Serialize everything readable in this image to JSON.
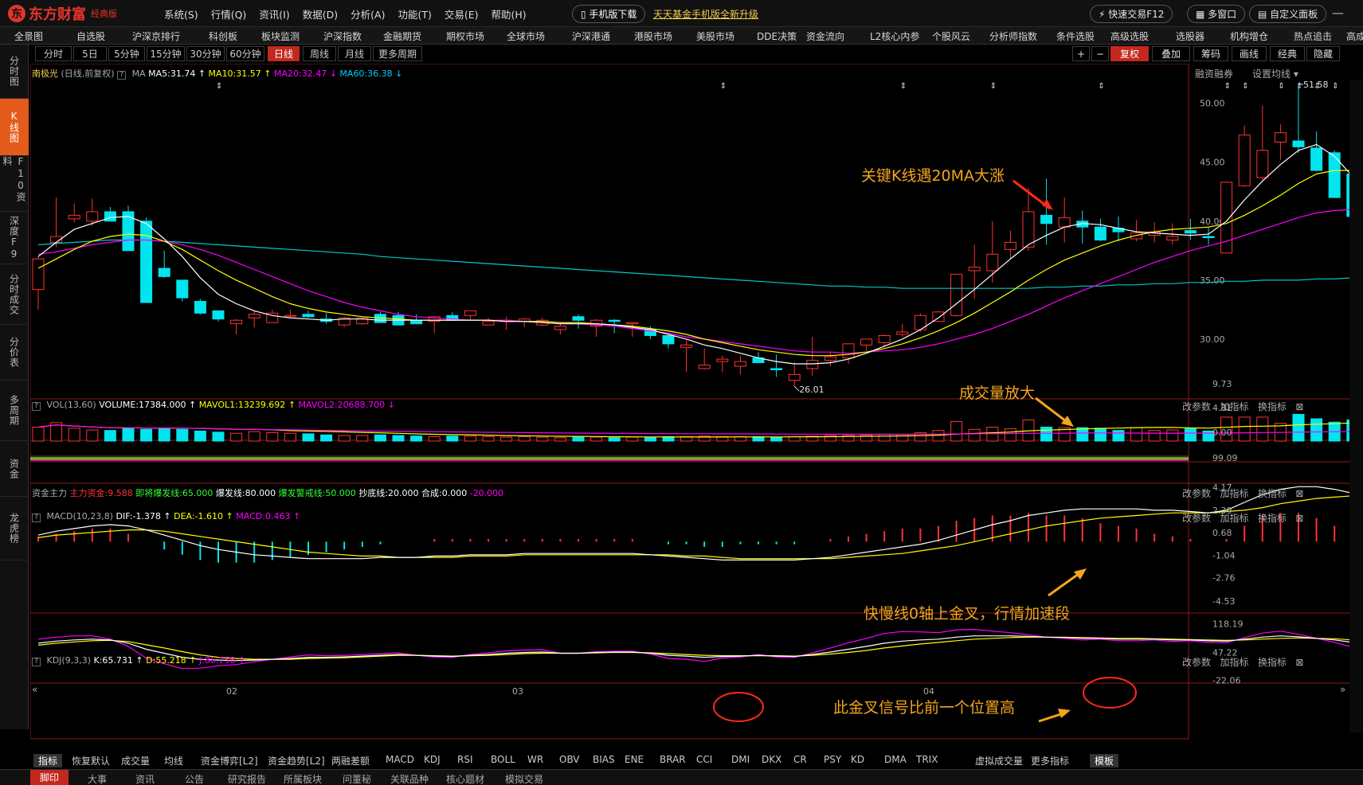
{
  "app": {
    "logo_text": "东方财富",
    "edition": "经典版"
  },
  "menu": [
    "系统(S)",
    "行情(Q)",
    "资讯(I)",
    "数据(D)",
    "分析(A)",
    "功能(T)",
    "交易(E)",
    "帮助(H)"
  ],
  "header": {
    "mobile_download": "手机版下载",
    "upgrade_link": "天天基金手机版全新升级",
    "quick_trade": "快速交易F12",
    "multi_window": "多窗口",
    "custom_panel": "自定义面板"
  },
  "nav": [
    "全景图",
    "自选股",
    "沪深京排行",
    "科创板",
    "板块监测",
    "沪深指数",
    "金融期货",
    "期权市场",
    "全球市场",
    "沪深港通",
    "港股市场",
    "美股市场",
    "DDE决策",
    "资金流向",
    "L2核心内参",
    "个股风云",
    "分析师指数",
    "条件选股",
    "高级选股",
    "选股器",
    "机构增仓",
    "热点追击",
    "高成长性",
    "机构"
  ],
  "periods": [
    "分时",
    "5日",
    "5分钟",
    "15分钟",
    "30分钟",
    "60分钟",
    "日线",
    "周线",
    "月线",
    "更多周期"
  ],
  "active_period": "日线",
  "toolbar": {
    "plus": "+",
    "minus": "−",
    "adjust": "复权",
    "overlay": "叠加",
    "chips": "筹码",
    "draw": "画线",
    "classic": "经典",
    "hide": "隐藏"
  },
  "sidebar": [
    "分时图",
    "K线图",
    "F10资料",
    "深度F9",
    "分时成交",
    "分价表",
    "多周期",
    "资金",
    "龙虎榜"
  ],
  "active_side": "K线图",
  "stock": {
    "name": "南极光",
    "mode": "(日线,前复权)",
    "ind": "MA",
    "ma5": "MA5:31.74",
    "ma10": "MA10:31.57",
    "ma20": "MA20:32.47",
    "ma60": "MA60:36.38",
    "margin": "融资融券",
    "set_ma": "设置均线"
  },
  "price_axis": [
    "50.00",
    "45.00",
    "40.00",
    "35.00",
    "30.00"
  ],
  "price_high": "51.58",
  "price_low": "26.01",
  "volume": {
    "title": "VOL(13,60)",
    "v": "VOLUME:17384.000",
    "m1": "MAVOL1:13239.692",
    "m2": "MAVOL2:20688.700",
    "axis": [
      "9.73",
      "4.81",
      "0.00"
    ]
  },
  "fund": {
    "title": "资金主力",
    "main": "主力资金:9.588",
    "about": "即将爆发线:65.000",
    "burst": "爆发线:80.000",
    "warn": "爆发警戒线:50.000",
    "bottom": "抄底线:20.000",
    "combo": "合成:0.000",
    "neg": "-20.000",
    "axis": "99.09"
  },
  "macd": {
    "title": "MACD(10,23,8)",
    "dif": "DIF:-1.378",
    "dea": "DEA:-1.610",
    "macd": "MACD:0.463",
    "axis": [
      "4.17",
      "2.39",
      "0.68",
      "-1.04",
      "-2.76",
      "-4.53"
    ]
  },
  "kdj": {
    "title": "KDJ(9,3,3)",
    "k": "K:65.731",
    "d": "D:55.218",
    "j": "J:86.758",
    "axis": [
      "118.19",
      "47.22",
      "-22.06"
    ]
  },
  "panel_controls": {
    "param": "改参数",
    "add": "加指标",
    "swap": "换指标"
  },
  "x_axis": [
    "02",
    "03",
    "04"
  ],
  "annotations": {
    "a1": "关键K线遇20MA大涨",
    "a2": "成交量放大",
    "a3": "快慢线0轴上金叉，行情加速段",
    "a4": "此金叉信号比前一个位置高"
  },
  "indicator_tabs": [
    "指标",
    "恢复默认",
    "成交量",
    "均线",
    "资金博弈[L2]",
    "资金趋势[L2]",
    "两融差额",
    "MACD",
    "KDJ",
    "RSI",
    "BOLL",
    "WR",
    "OBV",
    "BIAS",
    "ENE",
    "BRAR",
    "CCI",
    "DMI",
    "DKX",
    "CR",
    "PSY",
    "KD",
    "DMA",
    "TRIX",
    "虚拟成交量",
    "更多指标",
    "模板"
  ],
  "bottom_tabs": [
    "脚印",
    "大事",
    "资讯",
    "公告",
    "研究报告",
    "所属板块",
    "问董秘",
    "关联品种",
    "核心题材",
    "模拟交易"
  ],
  "colors": {
    "up": "#ff3232",
    "down": "#00e5ee",
    "ma5": "#ffffff",
    "ma10": "#ffff00",
    "ma20": "#ff00ff",
    "ma60": "#00c8c8",
    "accent": "#c3281e",
    "annotation": "#f4a51c"
  },
  "chart_data": {
    "type": "candlestick",
    "opens": [
      34.2,
      38.2,
      40.2,
      40.0,
      40.8,
      40.8,
      40.0,
      36.0,
      35.0,
      33.2,
      32.4,
      31.3,
      31.8,
      31.4,
      32.0,
      32.1,
      31.7,
      31.2,
      31.3,
      32.1,
      32.0,
      31.6,
      31.5,
      32.0,
      32.0,
      31.2,
      31.6,
      31.5,
      31.2,
      30.8,
      31.9,
      31.1,
      31.6,
      31.4,
      30.8,
      30.3,
      29.3,
      27.5,
      28.1,
      27.7,
      28.4,
      27.5,
      26.5,
      27.5,
      28.2,
      28.4,
      29.5,
      29.7,
      30.4,
      30.8,
      31.5,
      32.0,
      35.8,
      35.8,
      37.6,
      37.8,
      40.5,
      39.5,
      40.0,
      39.5,
      39.4,
      38.5,
      38.8,
      38.4,
      39.2,
      38.7,
      37.3,
      43.0,
      43.7,
      46.7,
      46.8,
      46.2,
      45.8,
      44.0,
      41.7,
      36.2,
      33.9,
      27.9,
      31.6
    ],
    "highs": [
      37.0,
      42.0,
      41.5,
      41.9,
      41.2,
      41.3,
      40.3,
      37.5,
      35.0,
      33.4,
      32.4,
      31.7,
      32.4,
      32.5,
      32.5,
      32.4,
      32.2,
      31.9,
      31.9,
      32.3,
      32.3,
      32.1,
      31.8,
      32.3,
      32.2,
      31.8,
      31.9,
      31.8,
      31.8,
      31.4,
      32.1,
      31.7,
      31.7,
      31.4,
      31.1,
      30.3,
      29.9,
      29.2,
      28.6,
      28.6,
      28.9,
      28.7,
      28.0,
      30.2,
      28.9,
      29.3,
      30.0,
      30.4,
      31.3,
      32.2,
      32.4,
      33.0,
      38.0,
      40.0,
      39.2,
      42.8,
      43.6,
      42.0,
      40.9,
      40.2,
      40.4,
      40.1,
      39.9,
      39.8,
      40.2,
      39.5,
      42.5,
      48.1,
      49.8,
      48.2,
      51.6,
      47.6,
      46.0,
      45.8,
      42.5,
      39.0,
      34.6,
      31.7,
      31.7
    ],
    "lows": [
      32.5,
      37.8,
      39.9,
      39.6,
      40.7,
      38.6,
      35.8,
      35.2,
      33.2,
      32.1,
      31.5,
      30.4,
      31.0,
      31.4,
      31.8,
      31.8,
      31.3,
      31.0,
      31.2,
      31.7,
      31.6,
      31.5,
      30.5,
      31.6,
      31.6,
      31.2,
      30.8,
      31.0,
      31.1,
      30.4,
      30.9,
      30.2,
      30.5,
      30.2,
      30.0,
      29.2,
      27.2,
      27.4,
      27.2,
      27.0,
      28.0,
      26.8,
      26.0,
      26.9,
      27.7,
      27.9,
      29.0,
      29.3,
      30.2,
      30.6,
      31.5,
      31.9,
      33.4,
      34.8,
      36.8,
      37.5,
      38.0,
      38.2,
      38.1,
      38.3,
      38.3,
      38.3,
      38.2,
      38.0,
      38.4,
      38.0,
      37.3,
      42.9,
      43.5,
      45.2,
      45.8,
      44.2,
      42.2,
      42.5,
      33.9,
      33.8,
      27.5,
      27.4,
      28.0
    ],
    "closes": [
      36.8,
      38.7,
      40.5,
      40.8,
      40.0,
      37.5,
      33.1,
      35.3,
      33.5,
      32.2,
      31.7,
      31.6,
      32.1,
      32.2,
      32.0,
      31.9,
      31.5,
      31.8,
      31.8,
      31.4,
      31.2,
      31.3,
      31.9,
      31.6,
      32.4,
      31.5,
      31.6,
      31.7,
      31.6,
      31.1,
      31.6,
      31.6,
      31.5,
      31.4,
      30.3,
      29.6,
      29.5,
      27.8,
      28.3,
      28.1,
      28.0,
      27.4,
      27.0,
      28.2,
      28.5,
      29.6,
      30.0,
      30.3,
      30.6,
      32.0,
      32.3,
      35.5,
      36.1,
      37.2,
      38.2,
      40.8,
      39.8,
      40.3,
      39.5,
      38.4,
      39.1,
      39.0,
      39.1,
      38.7,
      39.0,
      38.6,
      43.3,
      47.3,
      46.0,
      47.5,
      46.3,
      44.3,
      42.0,
      40.4,
      37.1,
      34.8,
      27.8,
      31.3,
      31.6
    ],
    "ma5": [
      37.0,
      38.2,
      39.3,
      39.8,
      40.3,
      40.4,
      39.8,
      38.5,
      37.0,
      35.2,
      33.8,
      33.0,
      32.4,
      32.0,
      31.8,
      31.7,
      31.6,
      31.7,
      31.7,
      31.6,
      31.6,
      31.6,
      31.6,
      31.6,
      31.6,
      31.6,
      31.5,
      31.5,
      31.4,
      31.3,
      31.3,
      31.3,
      31.2,
      31.0,
      30.8,
      30.4,
      30.0,
      29.5,
      29.2,
      28.8,
      28.4,
      28.1,
      27.9,
      27.9,
      28.0,
      28.3,
      28.8,
      29.4,
      30.0,
      30.8,
      31.8,
      33.0,
      34.2,
      35.5,
      36.8,
      38.0,
      38.8,
      39.5,
      39.8,
      39.7,
      39.4,
      39.1,
      39.0,
      38.9,
      38.8,
      38.9,
      40.0,
      41.8,
      43.4,
      44.8,
      46.0,
      46.5,
      45.5,
      43.8,
      41.6,
      39.0,
      36.0,
      33.5,
      32.5
    ],
    "ma10": [
      36.0,
      36.8,
      37.6,
      38.3,
      38.7,
      38.9,
      38.8,
      38.3,
      37.6,
      36.7,
      35.8,
      35.0,
      34.3,
      33.6,
      33.0,
      32.6,
      32.3,
      32.1,
      31.9,
      31.8,
      31.7,
      31.6,
      31.6,
      31.6,
      31.6,
      31.6,
      31.5,
      31.5,
      31.5,
      31.4,
      31.4,
      31.3,
      31.2,
      31.1,
      30.9,
      30.7,
      30.4,
      30.0,
      29.7,
      29.4,
      29.1,
      28.9,
      28.7,
      28.6,
      28.6,
      28.7,
      28.9,
      29.2,
      29.6,
      30.1,
      30.7,
      31.4,
      32.2,
      33.1,
      34.0,
      35.0,
      35.9,
      36.7,
      37.3,
      37.9,
      38.4,
      38.8,
      39.1,
      39.3,
      39.4,
      39.5,
      39.8,
      40.5,
      41.3,
      42.2,
      43.2,
      44.0,
      44.3,
      44.3,
      43.8,
      43.0,
      41.7,
      40.3,
      39.2
    ],
    "ma20": [
      37.2,
      37.4,
      37.7,
      38.0,
      38.2,
      38.4,
      38.4,
      38.3,
      38.0,
      37.6,
      37.1,
      36.5,
      35.9,
      35.3,
      34.7,
      34.1,
      33.6,
      33.1,
      32.7,
      32.4,
      32.1,
      31.9,
      31.8,
      31.7,
      31.6,
      31.6,
      31.6,
      31.5,
      31.5,
      31.4,
      31.3,
      31.2,
      31.1,
      30.9,
      30.7,
      30.5,
      30.2,
      30.0,
      29.8,
      29.6,
      29.4,
      29.2,
      29.0,
      28.9,
      28.9,
      28.8,
      28.9,
      29.0,
      29.1,
      29.3,
      29.6,
      30.0,
      30.4,
      30.9,
      31.5,
      32.1,
      32.8,
      33.5,
      34.1,
      34.7,
      35.3,
      35.9,
      36.5,
      37.0,
      37.5,
      37.9,
      38.3,
      38.8,
      39.3,
      39.8,
      40.3,
      40.7,
      40.9,
      41.0,
      41.1,
      41.0,
      40.8,
      40.6,
      40.3
    ],
    "ma60": [
      38.0,
      38.1,
      38.2,
      38.3,
      38.4,
      38.4,
      38.4,
      38.3,
      38.2,
      38.1,
      38.0,
      37.9,
      37.8,
      37.7,
      37.6,
      37.5,
      37.4,
      37.3,
      37.2,
      37.0,
      36.9,
      36.8,
      36.7,
      36.6,
      36.5,
      36.4,
      36.3,
      36.2,
      36.1,
      36.0,
      35.9,
      35.8,
      35.7,
      35.6,
      35.5,
      35.4,
      35.3,
      35.2,
      35.1,
      35.0,
      34.9,
      34.8,
      34.7,
      34.6,
      34.5,
      34.5,
      34.4,
      34.4,
      34.3,
      34.3,
      34.3,
      34.3,
      34.3,
      34.3,
      34.3,
      34.3,
      34.4,
      34.4,
      34.5,
      34.5,
      34.6,
      34.6,
      34.7,
      34.7,
      34.8,
      34.8,
      34.9,
      34.9,
      35.0,
      35.0,
      35.0,
      35.1,
      35.1,
      35.2,
      35.2,
      35.2,
      35.3,
      35.3,
      35.3
    ],
    "volume": [
      2.5,
      3.3,
      2.3,
      2.0,
      1.9,
      2.3,
      2.1,
      2.3,
      2.1,
      1.8,
      1.6,
      1.4,
      1.7,
      1.5,
      1.4,
      1.3,
      1.1,
      1.0,
      1.0,
      1.1,
      1.0,
      0.9,
      0.8,
      0.9,
      0.9,
      0.8,
      0.7,
      0.8,
      0.7,
      0.6,
      0.7,
      0.7,
      0.6,
      0.7,
      0.7,
      0.8,
      0.8,
      0.9,
      0.8,
      0.8,
      0.8,
      0.7,
      0.8,
      0.9,
      1.0,
      1.0,
      1.1,
      1.2,
      1.2,
      1.5,
      1.9,
      3.5,
      2.1,
      2.5,
      2.2,
      3.8,
      2.5,
      2.4,
      2.4,
      2.3,
      1.9,
      2.4,
      1.9,
      2.0,
      2.2,
      1.8,
      4.3,
      4.3,
      4.3,
      3.2,
      4.8,
      4.0,
      3.4,
      3.8,
      5.4,
      3.9,
      5.2,
      9.7,
      7.6
    ],
    "macd_dif": [
      0.5,
      0.8,
      1.0,
      1.2,
      1.3,
      1.2,
      0.9,
      0.5,
      0.1,
      -0.3,
      -0.6,
      -0.8,
      -1.0,
      -1.1,
      -1.2,
      -1.3,
      -1.3,
      -1.3,
      -1.3,
      -1.2,
      -1.2,
      -1.2,
      -1.1,
      -1.1,
      -1.0,
      -1.0,
      -1.0,
      -0.9,
      -0.9,
      -0.9,
      -0.9,
      -0.9,
      -0.9,
      -0.9,
      -1.0,
      -1.1,
      -1.2,
      -1.3,
      -1.4,
      -1.4,
      -1.4,
      -1.4,
      -1.4,
      -1.3,
      -1.2,
      -1.0,
      -0.8,
      -0.6,
      -0.4,
      -0.2,
      0.1,
      0.5,
      0.9,
      1.3,
      1.6,
      2.0,
      2.2,
      2.4,
      2.5,
      2.5,
      2.5,
      2.5,
      2.4,
      2.4,
      2.3,
      2.2,
      2.4,
      3.0,
      3.6,
      4.0,
      4.2,
      4.2,
      4.0,
      3.7,
      3.2,
      2.5,
      1.4,
      -0.2,
      -1.38
    ],
    "macd_dea": [
      0.3,
      0.5,
      0.6,
      0.7,
      0.8,
      0.9,
      0.9,
      0.8,
      0.6,
      0.4,
      0.2,
      0.0,
      -0.2,
      -0.4,
      -0.6,
      -0.8,
      -0.9,
      -1.0,
      -1.1,
      -1.1,
      -1.2,
      -1.2,
      -1.2,
      -1.2,
      -1.1,
      -1.1,
      -1.1,
      -1.0,
      -1.0,
      -1.0,
      -1.0,
      -1.0,
      -1.0,
      -1.0,
      -1.0,
      -1.0,
      -1.1,
      -1.1,
      -1.2,
      -1.3,
      -1.3,
      -1.3,
      -1.3,
      -1.3,
      -1.3,
      -1.2,
      -1.1,
      -1.0,
      -0.9,
      -0.7,
      -0.5,
      -0.3,
      0.0,
      0.3,
      0.6,
      0.9,
      1.2,
      1.4,
      1.6,
      1.8,
      1.9,
      2.0,
      2.1,
      2.2,
      2.2,
      2.2,
      2.3,
      2.4,
      2.6,
      2.9,
      3.1,
      3.3,
      3.4,
      3.5,
      3.4,
      3.2,
      2.8,
      2.1,
      -1.61
    ],
    "kdj_k": [
      70,
      75,
      78,
      80,
      78,
      70,
      55,
      45,
      35,
      30,
      28,
      27,
      28,
      30,
      32,
      35,
      35,
      36,
      38,
      40,
      42,
      40,
      38,
      37,
      40,
      42,
      45,
      47,
      48,
      45,
      45,
      47,
      48,
      48,
      45,
      40,
      38,
      35,
      37,
      38,
      40,
      38,
      37,
      42,
      48,
      55,
      62,
      70,
      75,
      78,
      80,
      85,
      88,
      88,
      88,
      87,
      85,
      84,
      82,
      82,
      80,
      80,
      80,
      78,
      78,
      76,
      75,
      80,
      85,
      88,
      86,
      82,
      78,
      72,
      65,
      55,
      45,
      40,
      35
    ],
    "kdj_d": [
      65,
      70,
      73,
      76,
      77,
      74,
      66,
      58,
      49,
      41,
      35,
      32,
      30,
      30,
      30,
      32,
      33,
      34,
      36,
      38,
      40,
      40,
      39,
      38,
      39,
      40,
      42,
      44,
      45,
      45,
      45,
      46,
      47,
      47,
      46,
      44,
      42,
      40,
      39,
      39,
      39,
      39,
      38,
      40,
      43,
      47,
      52,
      58,
      63,
      68,
      72,
      76,
      80,
      82,
      84,
      85,
      85,
      85,
      84,
      83,
      82,
      82,
      81,
      80,
      79,
      78,
      77,
      78,
      80,
      82,
      83,
      82,
      81,
      78,
      73,
      67,
      60,
      53,
      47
    ],
    "kdj_j": [
      80,
      85,
      88,
      88,
      80,
      62,
      33,
      19,
      7,
      8,
      14,
      17,
      24,
      30,
      36,
      41,
      39,
      40,
      42,
      44,
      46,
      40,
      36,
      35,
      42,
      46,
      51,
      53,
      54,
      45,
      45,
      49,
      50,
      50,
      43,
      32,
      30,
      25,
      33,
      36,
      42,
      36,
      35,
      46,
      58,
      71,
      82,
      94,
      99,
      98,
      96,
      103,
      104,
      100,
      96,
      91,
      85,
      82,
      78,
      80,
      76,
      76,
      78,
      74,
      76,
      72,
      71,
      84,
      95,
      100,
      92,
      82,
      72,
      60,
      49,
      31,
      15,
      14,
      11
    ]
  }
}
